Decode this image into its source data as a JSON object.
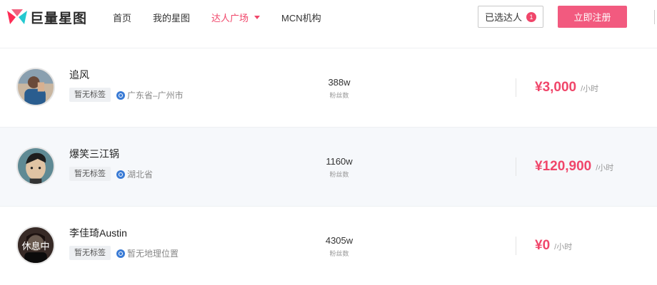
{
  "header": {
    "logo_text": "巨量星图",
    "nav": [
      {
        "label": "首页",
        "active": false
      },
      {
        "label": "我的星图",
        "active": false
      },
      {
        "label": "达人广场",
        "active": true
      },
      {
        "label": "MCN机构",
        "active": false
      }
    ],
    "selected_label": "已选达人",
    "selected_count": "1",
    "register_label": "立即注册",
    "accent_color": "#f0466a"
  },
  "list": [
    {
      "name": "追风",
      "tag": "暂无标签",
      "gender_icon": "male-icon",
      "location": "广东省–广州市",
      "fans": "388w",
      "fans_label": "粉丝数",
      "price": "¥3,000",
      "price_unit": "/小时",
      "status": ""
    },
    {
      "name": "爆笑三江锅",
      "tag": "暂无标签",
      "gender_icon": "male-icon",
      "location": "湖北省",
      "fans": "1160w",
      "fans_label": "粉丝数",
      "price": "¥120,900",
      "price_unit": "/小时",
      "status": ""
    },
    {
      "name": "李佳琦Austin",
      "tag": "暂无标签",
      "gender_icon": "male-icon",
      "location": "暂无地理位置",
      "fans": "4305w",
      "fans_label": "粉丝数",
      "price": "¥0",
      "price_unit": "/小时",
      "status": "休息中"
    }
  ]
}
